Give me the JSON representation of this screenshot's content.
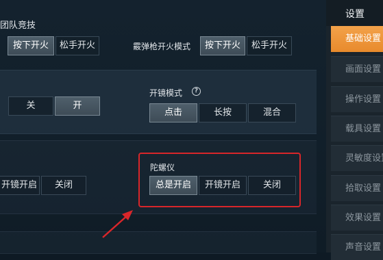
{
  "section_title": "团队竞技",
  "fire_mode": {
    "options": [
      "按下开火",
      "松手开火"
    ],
    "selected": 0
  },
  "grenade_fire": {
    "label": "霰弹枪开火模式",
    "options": [
      "按下开火",
      "松手开火"
    ],
    "selected": 0
  },
  "toggle_row": {
    "options": [
      "关",
      "开"
    ],
    "selected": 1
  },
  "scope_mode": {
    "label": "开镜模式",
    "help_icon": "question-circle-icon",
    "options": [
      "点击",
      "长按",
      "混合"
    ],
    "selected": 0
  },
  "left_gyro": {
    "options": [
      "开镜开启",
      "关闭"
    ]
  },
  "gyro": {
    "label": "陀螺仪",
    "options": [
      "总是开启",
      "开镜开启",
      "关闭"
    ],
    "selected": 0
  },
  "colors": {
    "accent_active_tab": "#f0963c",
    "highlight": "#d9262a"
  },
  "sidebar": {
    "header": "设置",
    "items": [
      {
        "label": "基础设置",
        "active": true
      },
      {
        "label": "画面设置",
        "active": false
      },
      {
        "label": "操作设置",
        "active": false
      },
      {
        "label": "载具设置",
        "active": false
      },
      {
        "label": "灵敏度设置",
        "active": false
      },
      {
        "label": "拾取设置",
        "active": false
      },
      {
        "label": "效果设置",
        "active": false
      },
      {
        "label": "声音设置",
        "active": false
      }
    ]
  }
}
